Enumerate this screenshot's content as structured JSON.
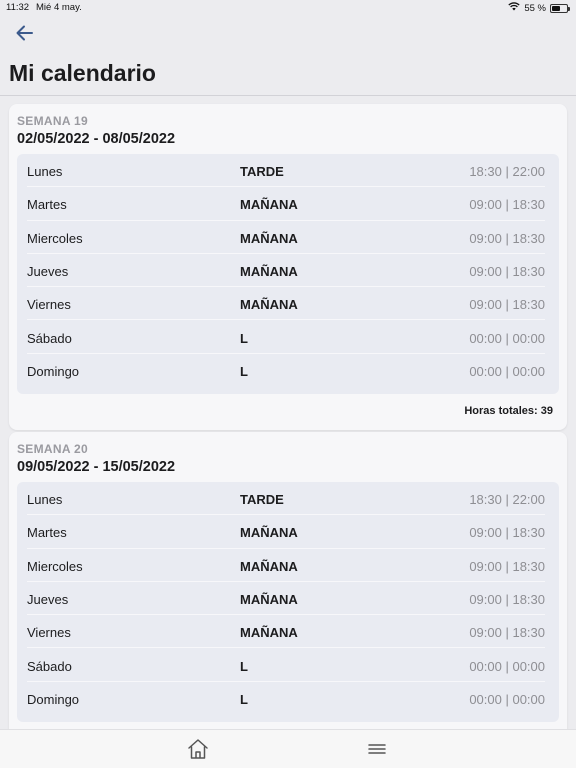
{
  "status_bar": {
    "time": "11:32",
    "date": "Mié 4 may.",
    "battery_text": "55 %",
    "battery_level": 0.55
  },
  "header": {
    "title": "Mi calendario",
    "back_icon": "arrow-left-icon"
  },
  "weeks": [
    {
      "label": "SEMANA 19",
      "range": "02/05/2022 - 08/05/2022",
      "days": [
        {
          "name": "Lunes",
          "shift": "TARDE",
          "hours": "18:30 | 22:00"
        },
        {
          "name": "Martes",
          "shift": "MAÑANA",
          "hours": "09:00 | 18:30"
        },
        {
          "name": "Miercoles",
          "shift": "MAÑANA",
          "hours": "09:00 | 18:30"
        },
        {
          "name": "Jueves",
          "shift": "MAÑANA",
          "hours": "09:00 | 18:30"
        },
        {
          "name": "Viernes",
          "shift": "MAÑANA",
          "hours": "09:00 | 18:30"
        },
        {
          "name": "Sábado",
          "shift": "L",
          "hours": "00:00 | 00:00"
        },
        {
          "name": "Domingo",
          "shift": "L",
          "hours": "00:00 | 00:00"
        }
      ],
      "total": "Horas totales: 39"
    },
    {
      "label": "SEMANA 20",
      "range": "09/05/2022 - 15/05/2022",
      "days": [
        {
          "name": "Lunes",
          "shift": "TARDE",
          "hours": "18:30 | 22:00"
        },
        {
          "name": "Martes",
          "shift": "MAÑANA",
          "hours": "09:00 | 18:30"
        },
        {
          "name": "Miercoles",
          "shift": "MAÑANA",
          "hours": "09:00 | 18:30"
        },
        {
          "name": "Jueves",
          "shift": "MAÑANA",
          "hours": "09:00 | 18:30"
        },
        {
          "name": "Viernes",
          "shift": "MAÑANA",
          "hours": "09:00 | 18:30"
        },
        {
          "name": "Sábado",
          "shift": "L",
          "hours": "00:00 | 00:00"
        },
        {
          "name": "Domingo",
          "shift": "L",
          "hours": "00:00 | 00:00"
        }
      ]
    }
  ],
  "tab_bar": {
    "home_icon": "home-icon",
    "menu_icon": "menu-icon"
  },
  "colors": {
    "background": "#ececef",
    "card": "#f7f7f9",
    "days_box": "#e9ebf2",
    "accent": "#3c5a8c",
    "muted": "#8e8e93"
  }
}
